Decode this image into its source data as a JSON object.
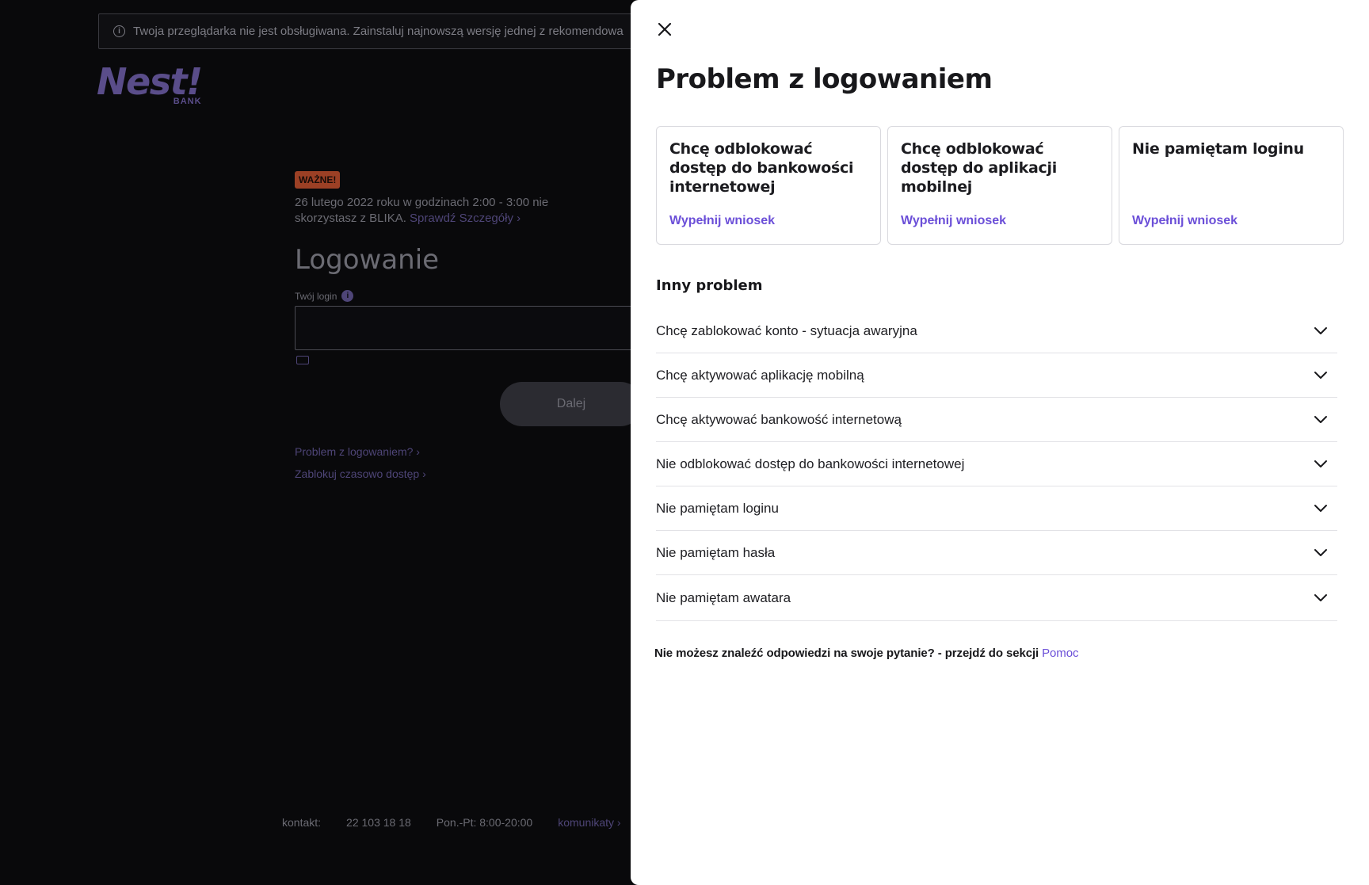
{
  "background": {
    "browser_banner": "Twoja przeglądarka nie jest obsługiwana. Zainstaluj najnowszą wersję jednej z rekomendowa",
    "logo": {
      "main": "Nest!",
      "sub": "BANK"
    },
    "notice": {
      "badge": "WAŻNE!",
      "text": "26 lutego 2022 roku w godzinach 2:00 - 3:00 nie skorzystasz  z BLIKA.",
      "link": "Sprawdź Szczegóły"
    },
    "login": {
      "title": "Logowanie",
      "label": "Twój login",
      "next_label": "Dalej"
    },
    "links": {
      "problem": "Problem z logowaniem?",
      "block": "Zablokuj czasowo dostęp"
    },
    "footer": {
      "contact_label": "kontakt:",
      "phone": "22 103 18 18",
      "hours": "Pon.-Pt: 8:00-20:00",
      "messages": "komunikaty"
    }
  },
  "panel": {
    "title": "Problem z logowaniem",
    "cards": [
      {
        "title": "Chcę odblokować dostęp do bankowości internetowej",
        "link": "Wypełnij wniosek"
      },
      {
        "title": "Chcę odblokować dostęp do aplikacji mobilnej",
        "link": "Wypełnij wniosek"
      },
      {
        "title": "Nie pamiętam loginu",
        "link": "Wypełnij wniosek"
      }
    ],
    "section_title": "Inny problem",
    "faq": [
      "Chcę zablokować konto - sytuacja awaryjna",
      "Chcę aktywować aplikację mobilną",
      "Chcę aktywować bankowość internetową",
      "Nie odblokować dostęp do bankowości internetowej",
      "Nie pamiętam loginu",
      "Nie pamiętam hasła",
      "Nie pamiętam awatara"
    ],
    "help": {
      "text": "Nie możesz znaleźć odpowiedzi na swoje pytanie? - przejdź do sekcji ",
      "link": "Pomoc"
    }
  },
  "colors": {
    "accent": "#6b4fd8",
    "panel_bg": "#ffffff",
    "backdrop": "#09090b"
  }
}
